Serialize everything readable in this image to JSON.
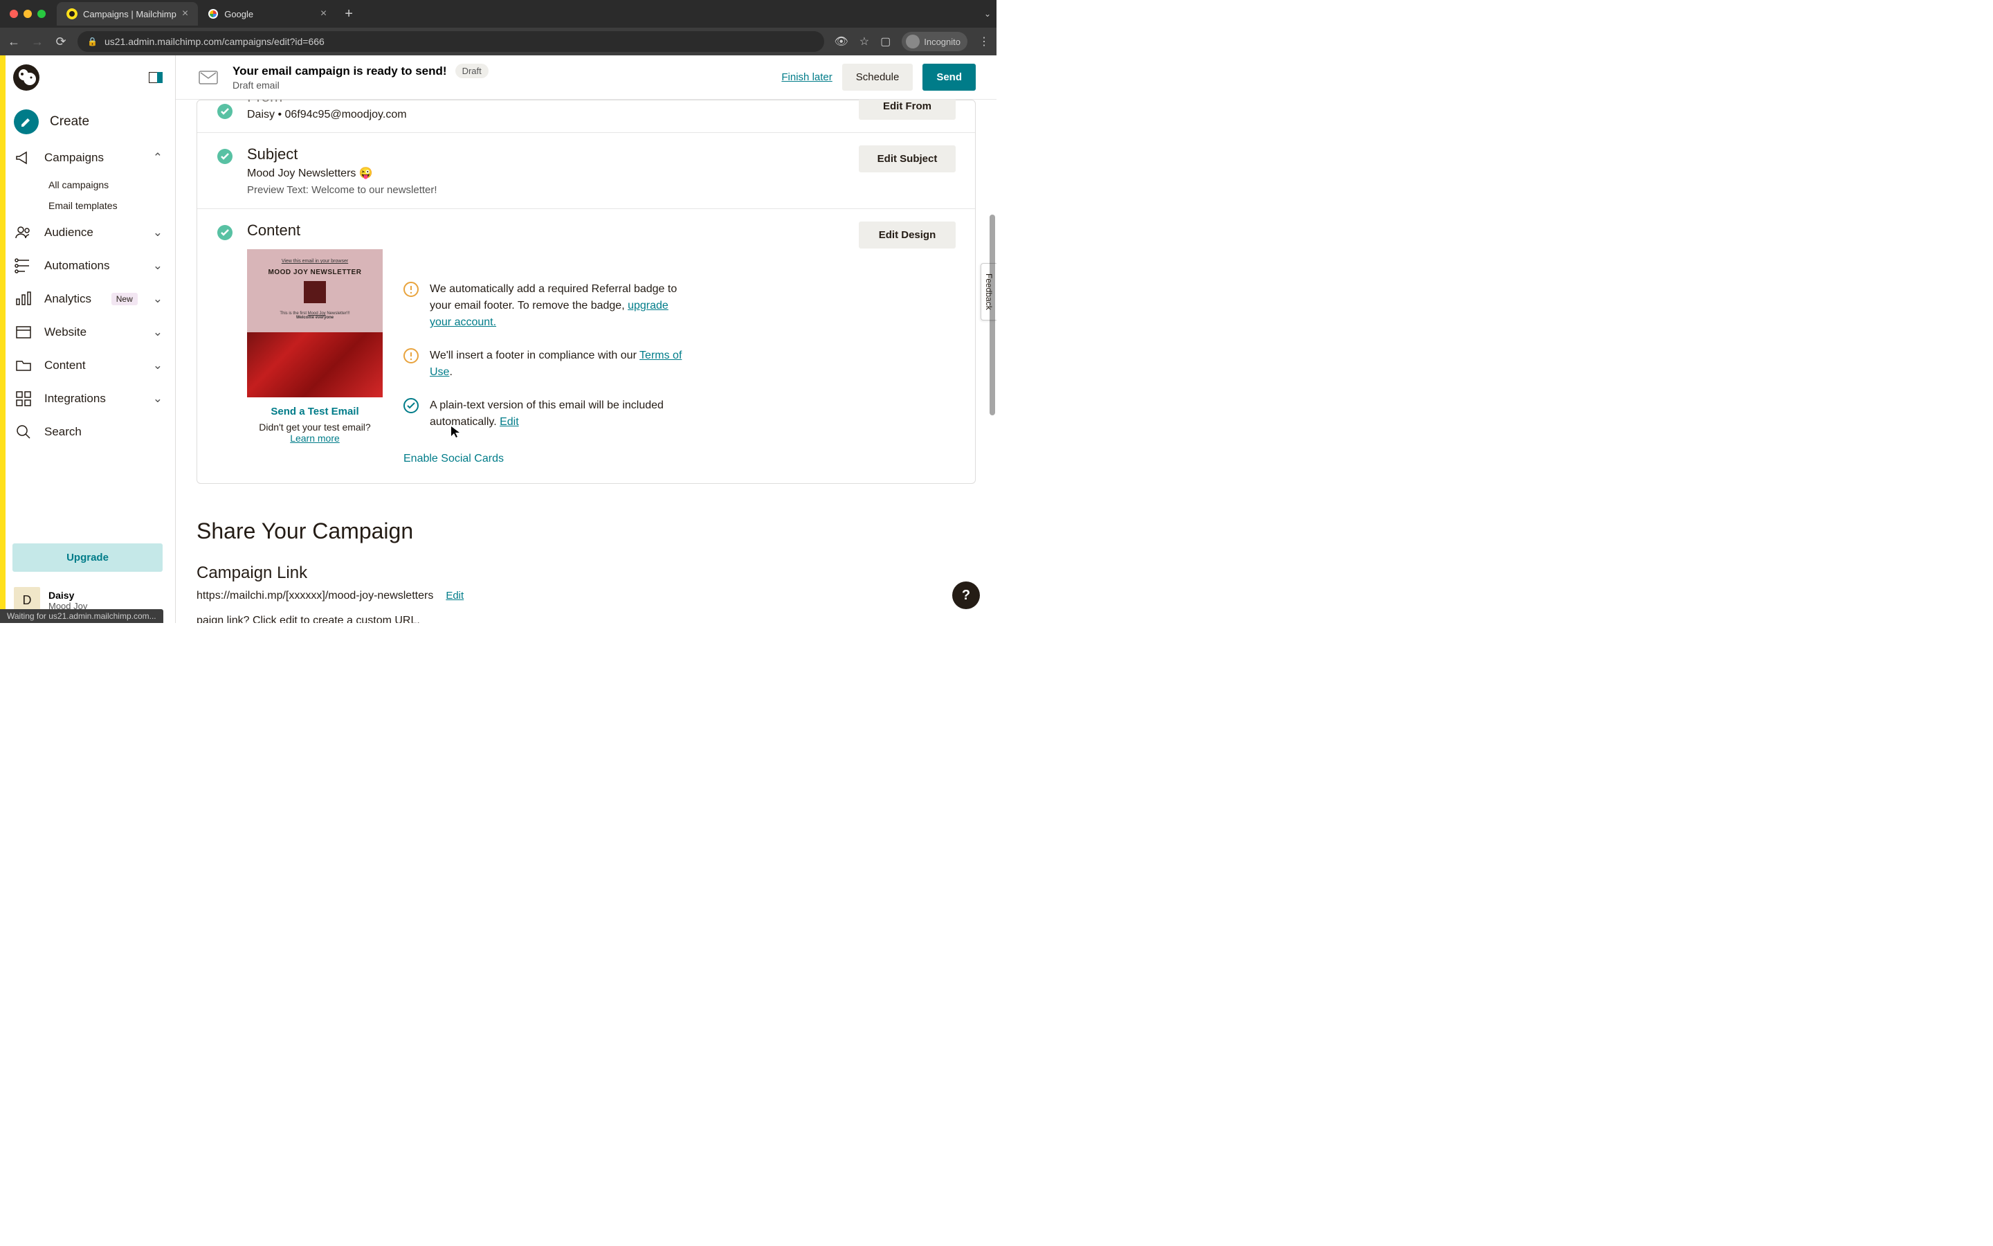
{
  "browser": {
    "tabs": [
      {
        "title": "Campaigns | Mailchimp",
        "active": true
      },
      {
        "title": "Google",
        "active": false
      }
    ],
    "url": "us21.admin.mailchimp.com/campaigns/edit?id=666",
    "incognito_label": "Incognito",
    "status_text": "Waiting for us21.admin.mailchimp.com..."
  },
  "sidebar": {
    "create": "Create",
    "items": [
      {
        "label": "Campaigns",
        "expanded": true,
        "sub": [
          "All campaigns",
          "Email templates"
        ]
      },
      {
        "label": "Audience"
      },
      {
        "label": "Automations"
      },
      {
        "label": "Analytics",
        "badge": "New"
      },
      {
        "label": "Website"
      },
      {
        "label": "Content"
      },
      {
        "label": "Integrations"
      },
      {
        "label": "Search"
      }
    ],
    "upgrade": "Upgrade",
    "user": {
      "initial": "D",
      "name": "Daisy",
      "org": "Mood Joy"
    }
  },
  "header": {
    "title": "Your email campaign is ready to send!",
    "badge": "Draft",
    "subtitle": "Draft email",
    "finish": "Finish later",
    "schedule": "Schedule",
    "send": "Send"
  },
  "sections": {
    "from": {
      "title": "From",
      "text": "Daisy • 06f94c95@moodjoy.com",
      "button": "Edit From"
    },
    "subject": {
      "title": "Subject",
      "text": "Mood Joy Newsletters 😜",
      "preview": "Preview Text: Welcome to our newsletter!",
      "button": "Edit Subject"
    },
    "content": {
      "title": "Content",
      "button": "Edit Design",
      "preview": {
        "view_link": "View this email in your browser",
        "brand": "MOOD JOY NEWSLETTER",
        "caption_prefix": "This is the first ",
        "caption_link": "Mood Joy",
        "caption_suffix": " Newsletter!!!",
        "welcome": "Welcome everyone"
      },
      "test_link": "Send a Test Email",
      "test_help_before": "Didn't get your test email? ",
      "test_help_link": "Learn more",
      "notices": [
        {
          "type": "warn",
          "text_before": "We automatically add a required Referral badge to your email footer. To remove the badge, ",
          "link": "upgrade your account."
        },
        {
          "type": "warn",
          "text_before": "We'll insert a footer in compliance with our ",
          "link": "Terms of Use",
          "text_after": "."
        },
        {
          "type": "ok",
          "text_before": "A plain-text version of this email will be included automatically. ",
          "link": "Edit"
        }
      ],
      "social": "Enable Social Cards"
    }
  },
  "share": {
    "title": "Share Your Campaign",
    "sub": "Campaign Link",
    "url": "https://mailchi.mp/[xxxxxx]/mood-joy-newsletters",
    "edit": "Edit",
    "help": "paign link? Click edit to create a custom URL."
  },
  "feedback": "Feedback",
  "colors": {
    "primary": "#007c89",
    "accent": "#ffe01b"
  }
}
